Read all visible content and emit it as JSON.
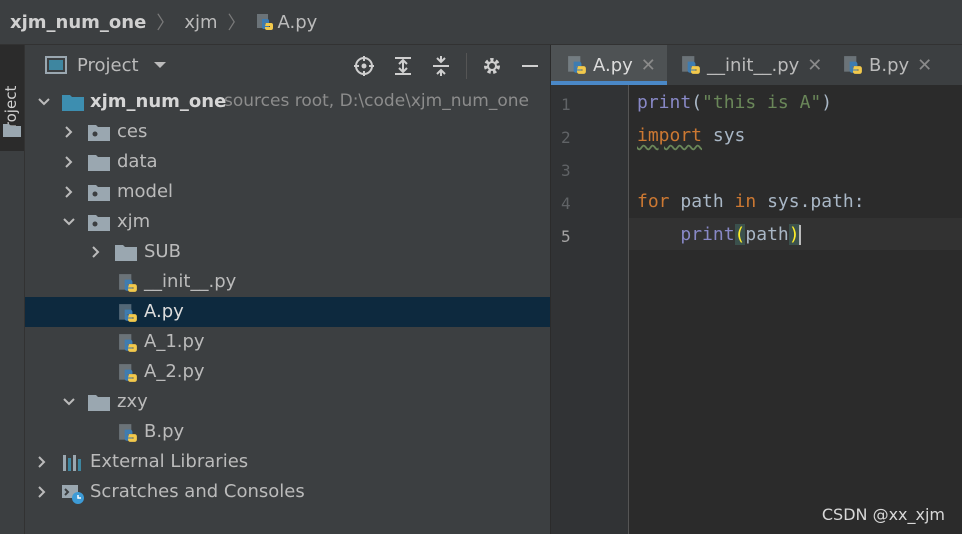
{
  "breadcrumb": {
    "root": "xjm_num_one",
    "folder": "xjm",
    "file": "A.py"
  },
  "side_strip": {
    "project_tab": "Project"
  },
  "project_panel": {
    "title": "Project",
    "toolbar_icons": [
      "locate-icon",
      "expand-all-icon",
      "collapse-all-icon",
      "gear-icon",
      "hide-icon"
    ]
  },
  "tree": {
    "root": {
      "name": "xjm_num_one",
      "hint": "sources root,  D:\\code\\xjm_num_one"
    },
    "ces": "ces",
    "data": "data",
    "model": "model",
    "xjm": "xjm",
    "sub": "SUB",
    "init": "__init__.py",
    "a": "A.py",
    "a1": "A_1.py",
    "a2": "A_2.py",
    "zxy": "zxy",
    "b": "B.py",
    "ext_libs": "External Libraries",
    "scratches": "Scratches and Consoles"
  },
  "editor": {
    "tabs": [
      {
        "label": "A.py",
        "active": true
      },
      {
        "label": "__init__.py",
        "active": false
      },
      {
        "label": "B.py",
        "active": false
      }
    ],
    "line_numbers": [
      "1",
      "2",
      "3",
      "4",
      "5"
    ],
    "code": {
      "l1_fn": "print",
      "l1_open": "(",
      "l1_str": "\"this is A\"",
      "l1_close": ")",
      "l2_kw": "import",
      "l2_rest": " sys",
      "l4_for": "for",
      "l4_var": " path ",
      "l4_in": "in",
      "l4_rest": " sys.path:",
      "l5_indent": "    ",
      "l5_fn": "print",
      "l5_open": "(",
      "l5_arg": "path",
      "l5_close": ")"
    }
  },
  "watermark": "CSDN @xx_xjm",
  "colors": {
    "selection": "#0d293e",
    "accent": "#4a88c7",
    "keyword": "#cc7832",
    "string": "#6a8759",
    "builtin": "#8888c6"
  }
}
